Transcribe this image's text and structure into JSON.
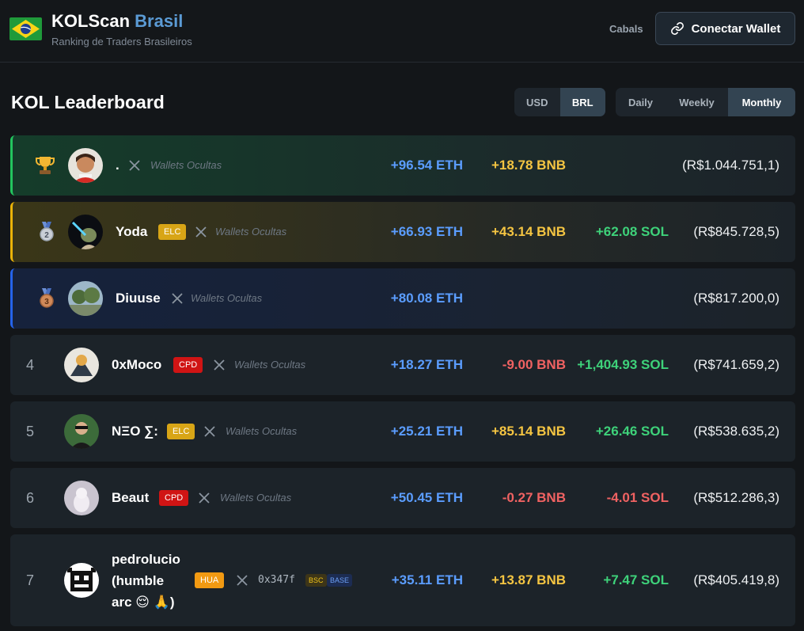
{
  "header": {
    "brand_main": "KOLScan",
    "brand_accent": "Brasil",
    "tagline": "Ranking de Traders Brasileiros",
    "nav_cabals": "Cabals",
    "connect_label": "Conectar Wallet"
  },
  "leaderboard": {
    "title": "KOL Leaderboard",
    "currency_options": [
      "USD",
      "BRL"
    ],
    "currency_selected": "BRL",
    "period_options": [
      "Daily",
      "Weekly",
      "Monthly"
    ],
    "period_selected": "Monthly"
  },
  "rows": [
    {
      "rank": "",
      "medal": "trophy",
      "name": ".",
      "badge": "",
      "wallet": "Wallets Ocultas",
      "eth": "+96.54 ETH",
      "bnb": "+18.78 BNB",
      "sol": "",
      "total": "(R$1.044.751,1)"
    },
    {
      "rank": "",
      "medal": "silver-medal",
      "name": "Yoda",
      "badge": "ELC",
      "wallet": "Wallets Ocultas",
      "eth": "+66.93 ETH",
      "bnb": "+43.14 BNB",
      "sol": "+62.08 SOL",
      "total": "(R$845.728,5)"
    },
    {
      "rank": "",
      "medal": "bronze-medal",
      "name": "Diuuse",
      "badge": "",
      "wallet": "Wallets Ocultas",
      "eth": "+80.08 ETH",
      "bnb": "",
      "sol": "",
      "total": "(R$817.200,0)"
    },
    {
      "rank": "4",
      "name": "0xMoco",
      "badge": "CPD",
      "wallet": "Wallets Ocultas",
      "eth": "+18.27 ETH",
      "bnb": "-9.00 BNB",
      "sol": "+1,404.93 SOL",
      "total": "(R$741.659,2)"
    },
    {
      "rank": "5",
      "name": "NΞO ∑:",
      "badge": "ELC",
      "wallet": "Wallets Ocultas",
      "eth": "+25.21 ETH",
      "bnb": "+85.14 BNB",
      "sol": "+26.46 SOL",
      "total": "(R$538.635,2)"
    },
    {
      "rank": "6",
      "name": "Beaut",
      "badge": "CPD",
      "wallet": "Wallets Ocultas",
      "eth": "+50.45 ETH",
      "bnb": "-0.27 BNB",
      "sol": "-4.01 SOL",
      "total": "(R$512.286,3)"
    },
    {
      "rank": "7",
      "name_lines": [
        "pedrolucio",
        "(humble",
        "arc 😌 🙏)"
      ],
      "badge": "HUA",
      "wallet_address": "0x347f",
      "chains": [
        "BSC",
        "BASE"
      ],
      "eth": "+35.11 ETH",
      "bnb": "+13.87 BNB",
      "sol": "+7.47 SOL",
      "total": "(R$405.419,8)"
    }
  ],
  "colors": {
    "eth": "#5b9dff",
    "bnb": "#f5c542",
    "sol": "#3ed27a",
    "negative": "#f06262",
    "elc_badge": "#d8a516",
    "cpd_badge": "#d01414",
    "hua_badge": "#f29a12"
  }
}
